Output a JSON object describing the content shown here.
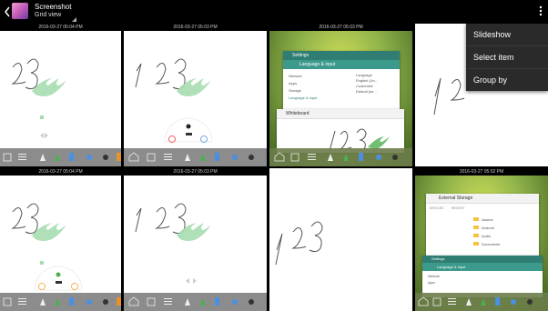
{
  "header": {
    "title": "Screenshot",
    "subtitle": "Grid view"
  },
  "overflow_menu": {
    "items": [
      "Slideshow",
      "Select item",
      "Group by"
    ]
  },
  "tiles": [
    {
      "date": "2016-03-27  05:04  PM"
    },
    {
      "date": "2016-03-27  05:03  PM"
    },
    {
      "date": "2016-03-27  05:03  PM"
    },
    {
      "date": ""
    },
    {
      "date": "2016-03-27  05:04  PM"
    },
    {
      "date": "2016-03-27  05:03  PM"
    },
    {
      "date": ""
    },
    {
      "date": "2016-03-27  05:02  PM"
    }
  ],
  "settings_window": {
    "title": "Settings",
    "section": "Language & input",
    "items": [
      "Network",
      "Apps",
      "Storage",
      "Language & input"
    ],
    "right_items": [
      "Language",
      "English (Un...",
      "Customize",
      "Default (ke..."
    ]
  },
  "whiteboard_window": {
    "title": "Whiteboard"
  },
  "storage_window": {
    "title": "External Storage",
    "headers": [
      "DEVICES",
      "RECENT"
    ],
    "folders": [
      "Alarms",
      "Android",
      "Audio",
      "Documents"
    ]
  },
  "colors": {
    "topbar": "#000000",
    "menu": "#2a2a2a",
    "green_scribble": "#a6ddb0",
    "green_accent": "#4caf50",
    "toolbar": "#888888",
    "desktop_green": "#8fb24a"
  }
}
